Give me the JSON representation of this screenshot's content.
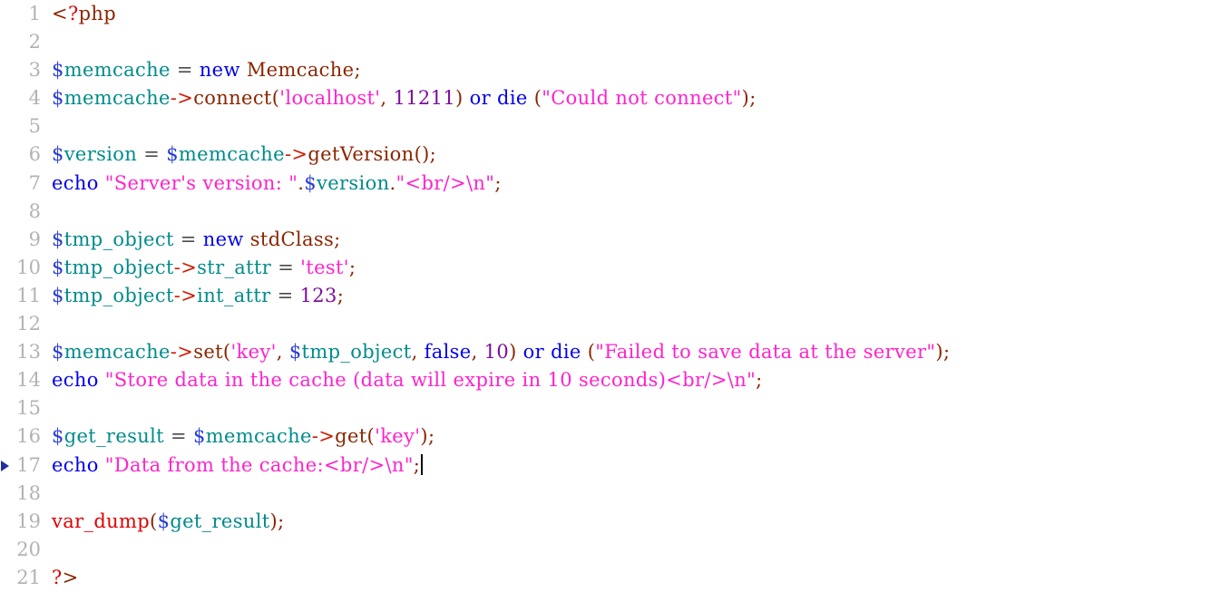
{
  "editor": {
    "language": "php",
    "background_color": "#ffffff",
    "gutter_color": "#b3b3b3",
    "current_line": 17,
    "marker_glyph": "▶",
    "caret_line": 17,
    "colors": {
      "open_tag": "#8b2500",
      "question_mark": "#e00000",
      "variable_sigil": "#2b3fd4",
      "variable_name": "#008b8b",
      "keyword": "#0000ee",
      "class_name": "#8b2500",
      "object_operator": "#d11a00",
      "function_name": "#e00000",
      "string": "#ff22cc",
      "number": "#7b0f9e",
      "punctuation": "#8b2500",
      "operator": "#4a4a4a",
      "caret": "#000000",
      "marker": "#1f2fa0"
    },
    "lines": [
      {
        "n": "1",
        "text": "<?php"
      },
      {
        "n": "2",
        "text": ""
      },
      {
        "n": "3",
        "text": "$memcache = new Memcache;"
      },
      {
        "n": "4",
        "text": "$memcache->connect('localhost', 11211) or die (\"Could not connect\");"
      },
      {
        "n": "5",
        "text": ""
      },
      {
        "n": "6",
        "text": "$version = $memcache->getVersion();"
      },
      {
        "n": "7",
        "text": "echo \"Server's version: \".$version.\"<br/>\\n\";"
      },
      {
        "n": "8",
        "text": ""
      },
      {
        "n": "9",
        "text": "$tmp_object = new stdClass;"
      },
      {
        "n": "10",
        "text": "$tmp_object->str_attr = 'test';"
      },
      {
        "n": "11",
        "text": "$tmp_object->int_attr = 123;"
      },
      {
        "n": "12",
        "text": ""
      },
      {
        "n": "13",
        "text": "$memcache->set('key', $tmp_object, false, 10) or die (\"Failed to save data at the server\");"
      },
      {
        "n": "14",
        "text": "echo \"Store data in the cache (data will expire in 10 seconds)<br/>\\n\";"
      },
      {
        "n": "15",
        "text": ""
      },
      {
        "n": "16",
        "text": "$get_result = $memcache->get('key');"
      },
      {
        "n": "17",
        "text": "echo \"Data from the cache:<br/>\\n\";"
      },
      {
        "n": "18",
        "text": ""
      },
      {
        "n": "19",
        "text": "var_dump($get_result);"
      },
      {
        "n": "20",
        "text": ""
      },
      {
        "n": "21",
        "text": "?>"
      }
    ],
    "tokens": {
      "l1": [
        [
          "<",
          "t-tag"
        ],
        [
          "?",
          "t-qmark"
        ],
        [
          "php",
          "t-tag"
        ]
      ],
      "l3": [
        [
          "$",
          "t-sigil"
        ],
        [
          "memcache",
          "t-var"
        ],
        [
          " ",
          "t-plain"
        ],
        [
          "=",
          "t-op"
        ],
        [
          " ",
          "t-plain"
        ],
        [
          "new",
          "t-kw"
        ],
        [
          " ",
          "t-plain"
        ],
        [
          "Memcache",
          "t-class"
        ],
        [
          ";",
          "t-punc"
        ]
      ],
      "l4": [
        [
          "$",
          "t-sigil"
        ],
        [
          "memcache",
          "t-var"
        ],
        [
          "->",
          "t-arrow"
        ],
        [
          "connect",
          "t-method"
        ],
        [
          "(",
          "t-punc"
        ],
        [
          "'localhost'",
          "t-str"
        ],
        [
          ", ",
          "t-punc"
        ],
        [
          "11211",
          "t-num"
        ],
        [
          ")",
          "t-punc"
        ],
        [
          " ",
          "t-plain"
        ],
        [
          "or die",
          "t-kw"
        ],
        [
          " ",
          "t-plain"
        ],
        [
          "(",
          "t-punc"
        ],
        [
          "\"Could not connect\"",
          "t-str"
        ],
        [
          ")",
          "t-punc"
        ],
        [
          ";",
          "t-punc"
        ]
      ],
      "l6": [
        [
          "$",
          "t-sigil"
        ],
        [
          "version",
          "t-var"
        ],
        [
          " ",
          "t-plain"
        ],
        [
          "=",
          "t-op"
        ],
        [
          " ",
          "t-plain"
        ],
        [
          "$",
          "t-sigil"
        ],
        [
          "memcache",
          "t-var"
        ],
        [
          "->",
          "t-arrow"
        ],
        [
          "getVersion",
          "t-method"
        ],
        [
          "()",
          "t-punc"
        ],
        [
          ";",
          "t-punc"
        ]
      ],
      "l7": [
        [
          "echo",
          "t-kw"
        ],
        [
          " ",
          "t-plain"
        ],
        [
          "\"Server's version: \"",
          "t-str"
        ],
        [
          ".",
          "t-punc"
        ],
        [
          "$",
          "t-sigil"
        ],
        [
          "version",
          "t-var"
        ],
        [
          ".",
          "t-punc"
        ],
        [
          "\"<br/>\\n\"",
          "t-str"
        ],
        [
          ";",
          "t-punc"
        ]
      ],
      "l9": [
        [
          "$",
          "t-sigil"
        ],
        [
          "tmp_object",
          "t-var"
        ],
        [
          " ",
          "t-plain"
        ],
        [
          "=",
          "t-op"
        ],
        [
          " ",
          "t-plain"
        ],
        [
          "new",
          "t-kw"
        ],
        [
          " ",
          "t-plain"
        ],
        [
          "stdClass",
          "t-class"
        ],
        [
          ";",
          "t-punc"
        ]
      ],
      "l10": [
        [
          "$",
          "t-sigil"
        ],
        [
          "tmp_object",
          "t-var"
        ],
        [
          "->",
          "t-arrow"
        ],
        [
          "str_attr",
          "t-var"
        ],
        [
          " ",
          "t-plain"
        ],
        [
          "=",
          "t-op"
        ],
        [
          " ",
          "t-plain"
        ],
        [
          "'test'",
          "t-str"
        ],
        [
          ";",
          "t-punc"
        ]
      ],
      "l11": [
        [
          "$",
          "t-sigil"
        ],
        [
          "tmp_object",
          "t-var"
        ],
        [
          "->",
          "t-arrow"
        ],
        [
          "int_attr",
          "t-var"
        ],
        [
          " ",
          "t-plain"
        ],
        [
          "=",
          "t-op"
        ],
        [
          " ",
          "t-plain"
        ],
        [
          "123",
          "t-num"
        ],
        [
          ";",
          "t-punc"
        ]
      ],
      "l13": [
        [
          "$",
          "t-sigil"
        ],
        [
          "memcache",
          "t-var"
        ],
        [
          "->",
          "t-arrow"
        ],
        [
          "set",
          "t-method"
        ],
        [
          "(",
          "t-punc"
        ],
        [
          "'key'",
          "t-str"
        ],
        [
          ", ",
          "t-punc"
        ],
        [
          "$",
          "t-sigil"
        ],
        [
          "tmp_object",
          "t-var"
        ],
        [
          ", ",
          "t-punc"
        ],
        [
          "false",
          "t-kw"
        ],
        [
          ", ",
          "t-punc"
        ],
        [
          "10",
          "t-num"
        ],
        [
          ")",
          "t-punc"
        ],
        [
          " ",
          "t-plain"
        ],
        [
          "or die",
          "t-kw"
        ],
        [
          " ",
          "t-plain"
        ],
        [
          "(",
          "t-punc"
        ],
        [
          "\"Failed to save data at the server\"",
          "t-str"
        ],
        [
          ")",
          "t-punc"
        ],
        [
          ";",
          "t-punc"
        ]
      ],
      "l14": [
        [
          "echo",
          "t-kw"
        ],
        [
          " ",
          "t-plain"
        ],
        [
          "\"Store data in the cache (data will expire in 10 seconds)<br/>\\n\"",
          "t-str"
        ],
        [
          ";",
          "t-punc"
        ]
      ],
      "l16": [
        [
          "$",
          "t-sigil"
        ],
        [
          "get_result",
          "t-var"
        ],
        [
          " ",
          "t-plain"
        ],
        [
          "=",
          "t-op"
        ],
        [
          " ",
          "t-plain"
        ],
        [
          "$",
          "t-sigil"
        ],
        [
          "memcache",
          "t-var"
        ],
        [
          "->",
          "t-arrow"
        ],
        [
          "get",
          "t-method"
        ],
        [
          "(",
          "t-punc"
        ],
        [
          "'key'",
          "t-str"
        ],
        [
          ")",
          "t-punc"
        ],
        [
          ";",
          "t-punc"
        ]
      ],
      "l17": [
        [
          "echo",
          "t-kw"
        ],
        [
          " ",
          "t-plain"
        ],
        [
          "\"Data from the cache:<br/>\\n\"",
          "t-str"
        ],
        [
          ";",
          "t-punc"
        ]
      ],
      "l19": [
        [
          "var_dump",
          "t-func"
        ],
        [
          "(",
          "t-punc"
        ],
        [
          "$",
          "t-sigil"
        ],
        [
          "get_result",
          "t-var"
        ],
        [
          ")",
          "t-punc"
        ],
        [
          ";",
          "t-punc"
        ]
      ],
      "l21": [
        [
          "?",
          "t-qmark"
        ],
        [
          ">",
          "t-tag"
        ]
      ]
    }
  }
}
